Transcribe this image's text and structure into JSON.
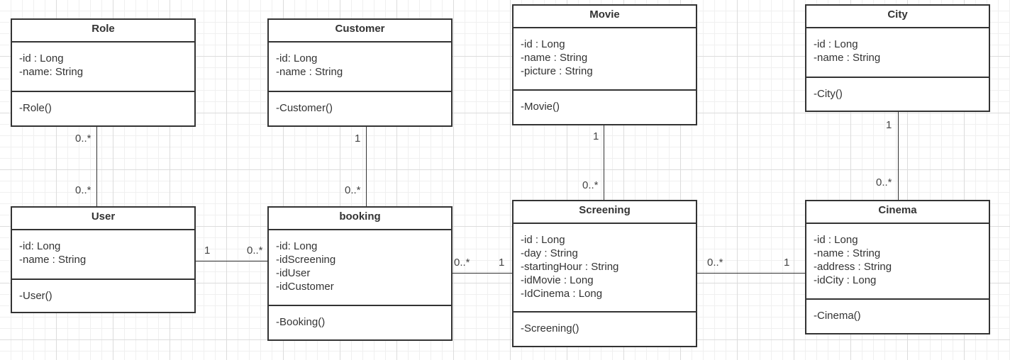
{
  "classes": {
    "role": {
      "name": "Role",
      "attrs": [
        "-id : Long",
        "-name: String"
      ],
      "ops": [
        "-Role()"
      ]
    },
    "customer": {
      "name": "Customer",
      "attrs": [
        "-id: Long",
        "-name : String"
      ],
      "ops": [
        "-Customer()"
      ]
    },
    "movie": {
      "name": "Movie",
      "attrs": [
        "-id : Long",
        "-name : String",
        "-picture : String"
      ],
      "ops": [
        "-Movie()"
      ]
    },
    "city": {
      "name": "City",
      "attrs": [
        "-id : Long",
        "-name : String"
      ],
      "ops": [
        "-City()"
      ]
    },
    "user": {
      "name": "User",
      "attrs": [
        "-id: Long",
        "-name : String"
      ],
      "ops": [
        "-User()"
      ]
    },
    "booking": {
      "name": "booking",
      "attrs": [
        "-id: Long",
        "-idScreening",
        "-idUser",
        "-idCustomer"
      ],
      "ops": [
        "-Booking()"
      ]
    },
    "screening": {
      "name": "Screening",
      "attrs": [
        "-id : Long",
        "-day : String",
        "-startingHour : String",
        "-idMovie : Long",
        "-IdCinema : Long"
      ],
      "ops": [
        "-Screening()"
      ]
    },
    "cinema": {
      "name": "Cinema",
      "attrs": [
        "-id : Long",
        "-name : String",
        "-address : String",
        "-idCity : Long"
      ],
      "ops": [
        "-Cinema()"
      ]
    }
  },
  "multiplicities": {
    "role_user_top": "0..*",
    "role_user_bottom": "0..*",
    "customer_booking_top": "1",
    "customer_booking_bottom": "0..*",
    "movie_screening_top": "1",
    "movie_screening_bottom": "0..*",
    "city_cinema_top": "1",
    "city_cinema_bottom": "0..*",
    "user_booking_left": "1",
    "user_booking_right": "0..*",
    "booking_screening_left": "0..*",
    "booking_screening_right": "1",
    "screening_cinema_left": "0..*",
    "screening_cinema_right": "1"
  }
}
